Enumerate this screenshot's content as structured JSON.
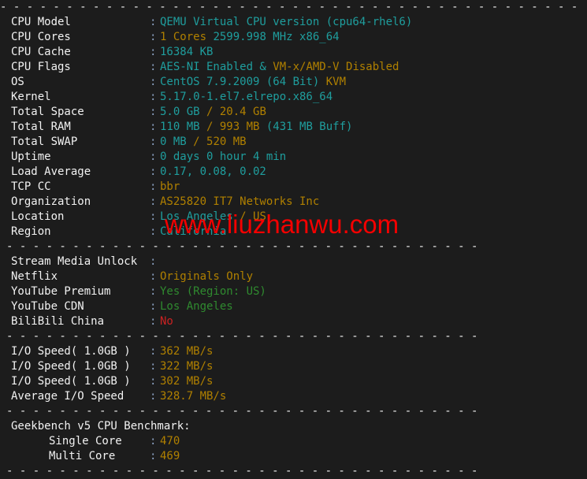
{
  "terminal": {
    "background": "#1c1c1c",
    "colors": {
      "label": "#f2f2f2",
      "colon": "#8aa0c0",
      "cyan": "#1f9e9e",
      "amber": "#b08000",
      "green": "#2f8a2f",
      "red": "#cc2222",
      "separator": "#efefef",
      "watermark": "#f40000"
    },
    "separator_full": "- - - - - - - - - - - - - - - - - - - - - - - - - - - - - - - - - - - - - - - - - - - - - - - - - - - - - - - - - - - - - - - - - - - - - - - - - - - - - - -",
    "separator_inset": "-------------------------------------------------------------------------------------------------"
  },
  "watermark": {
    "text": "www.liuzhanwu.com"
  },
  "system_info": [
    {
      "label": "CPU Model",
      "colon": ":",
      "parts": [
        {
          "text": "QEMU Virtual CPU version (cpu64-rhel6)",
          "color": "cyan"
        }
      ]
    },
    {
      "label": "CPU Cores",
      "colon": ":",
      "parts": [
        {
          "text": "1 Cores",
          "color": "amber"
        },
        {
          "text": " 2599.998 MHz x86_64",
          "color": "cyan"
        }
      ]
    },
    {
      "label": "CPU Cache",
      "colon": ":",
      "parts": [
        {
          "text": "16384 KB",
          "color": "cyan"
        }
      ]
    },
    {
      "label": "CPU Flags",
      "colon": ":",
      "parts": [
        {
          "text": "AES-NI Enabled & ",
          "color": "cyan"
        },
        {
          "text": "VM-x/AMD-V Disabled",
          "color": "amber"
        }
      ]
    },
    {
      "label": "OS",
      "colon": ":",
      "parts": [
        {
          "text": "CentOS 7.9.2009 (64 Bit) ",
          "color": "cyan"
        },
        {
          "text": "KVM",
          "color": "amber"
        }
      ]
    },
    {
      "label": "Kernel",
      "colon": ":",
      "parts": [
        {
          "text": "5.17.0-1.el7.elrepo.x86_64",
          "color": "cyan"
        }
      ]
    },
    {
      "label": "Total Space",
      "colon": ":",
      "parts": [
        {
          "text": "5.0 GB ",
          "color": "cyan"
        },
        {
          "text": "/ 20.4 GB",
          "color": "amber"
        }
      ]
    },
    {
      "label": "Total RAM",
      "colon": ":",
      "parts": [
        {
          "text": "110 MB ",
          "color": "cyan"
        },
        {
          "text": "/ 993 MB ",
          "color": "amber"
        },
        {
          "text": "(431 MB Buff)",
          "color": "cyan"
        }
      ]
    },
    {
      "label": "Total SWAP",
      "colon": ":",
      "parts": [
        {
          "text": "0 MB ",
          "color": "cyan"
        },
        {
          "text": "/ 520 MB",
          "color": "amber"
        }
      ]
    },
    {
      "label": "Uptime",
      "colon": ":",
      "parts": [
        {
          "text": "0 days 0 hour 4 min",
          "color": "cyan"
        }
      ]
    },
    {
      "label": "Load Average",
      "colon": ":",
      "parts": [
        {
          "text": "0.17, 0.08, 0.02",
          "color": "cyan"
        }
      ]
    },
    {
      "label": "TCP CC",
      "colon": ":",
      "parts": [
        {
          "text": "bbr",
          "color": "amber"
        }
      ]
    },
    {
      "label": "Organization",
      "colon": ":",
      "parts": [
        {
          "text": "AS25820 IT7 Networks Inc",
          "color": "amber"
        }
      ]
    },
    {
      "label": "Location",
      "colon": ":",
      "parts": [
        {
          "text": "Los Angeles ",
          "color": "cyan"
        },
        {
          "text": "/ US",
          "color": "amber"
        }
      ]
    },
    {
      "label": "Region",
      "colon": ":",
      "parts": [
        {
          "text": "California",
          "color": "cyan"
        }
      ]
    }
  ],
  "stream_media": {
    "heading": {
      "label": "Stream Media Unlock",
      "colon": ":",
      "parts": []
    },
    "rows": [
      {
        "label": "Netflix",
        "colon": ":",
        "parts": [
          {
            "text": "Originals Only",
            "color": "amber"
          }
        ]
      },
      {
        "label": "YouTube Premium",
        "colon": ":",
        "parts": [
          {
            "text": "Yes (Region: US)",
            "color": "green"
          }
        ]
      },
      {
        "label": "YouTube CDN",
        "colon": ":",
        "parts": [
          {
            "text": "Los Angeles",
            "color": "green"
          }
        ]
      },
      {
        "label": "BiliBili China",
        "colon": ":",
        "parts": [
          {
            "text": "No",
            "color": "red"
          }
        ]
      }
    ]
  },
  "io_tests": [
    {
      "label": "I/O Speed( 1.0GB )",
      "colon": ":",
      "parts": [
        {
          "text": "362 MB/s",
          "color": "amber"
        }
      ]
    },
    {
      "label": "I/O Speed( 1.0GB )",
      "colon": ":",
      "parts": [
        {
          "text": "322 MB/s",
          "color": "amber"
        }
      ]
    },
    {
      "label": "I/O Speed( 1.0GB )",
      "colon": ":",
      "parts": [
        {
          "text": "302 MB/s",
          "color": "amber"
        }
      ]
    },
    {
      "label": "Average I/O Speed",
      "colon": ":",
      "parts": [
        {
          "text": "328.7 MB/s",
          "color": "amber"
        }
      ]
    }
  ],
  "geekbench": {
    "heading": "Geekbench v5 CPU Benchmark:",
    "rows": [
      {
        "label": "Single Core",
        "colon": ":",
        "parts": [
          {
            "text": "470",
            "color": "amber"
          }
        ],
        "indent": true
      },
      {
        "label": "Multi Core",
        "colon": ":",
        "parts": [
          {
            "text": "469",
            "color": "amber"
          }
        ],
        "indent": true
      }
    ]
  }
}
